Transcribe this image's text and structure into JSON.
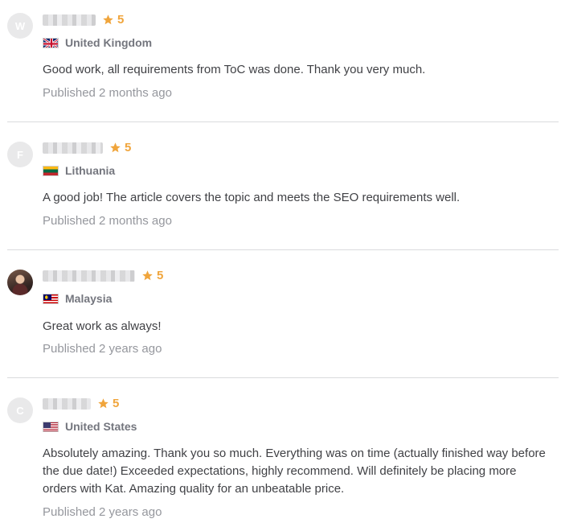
{
  "reviews": [
    {
      "avatar_initial": "W",
      "rating": "5",
      "country": "United Kingdom",
      "flag": "uk-flag",
      "text": "Good work, all requirements from ToC was done. Thank you very much.",
      "published": "Published 2 months ago"
    },
    {
      "avatar_initial": "F",
      "rating": "5",
      "country": "Lithuania",
      "flag": "lithuania-flag",
      "text": "A good job! The article covers the topic and meets the SEO requirements well.",
      "published": "Published 2 months ago"
    },
    {
      "avatar_initial": "",
      "rating": "5",
      "country": "Malaysia",
      "flag": "malaysia-flag",
      "text": "Great work as always!",
      "published": "Published 2 years ago"
    },
    {
      "avatar_initial": "C",
      "rating": "5",
      "country": "United States",
      "flag": "usa-flag",
      "text": "Absolutely amazing. Thank you so much. Everything was on time (actually finished way before the due date!) Exceeded expectations, highly recommend. Will definitely be placing more orders with Kat. Amazing quality for an unbeatable price.",
      "published": "Published 2 years ago"
    }
  ],
  "colors": {
    "star": "#f0a53c",
    "text": "#404145",
    "muted": "#95979d",
    "divider": "#dadbdd"
  }
}
